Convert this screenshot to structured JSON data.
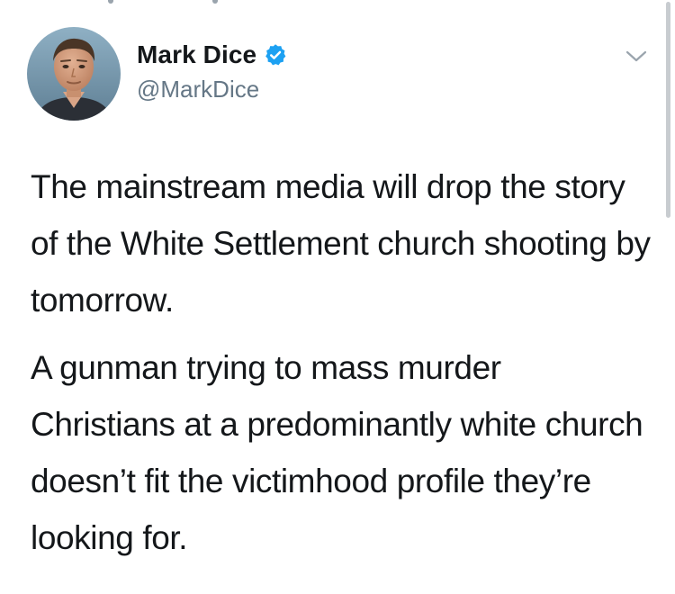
{
  "tweet": {
    "author": {
      "display_name": "Mark Dice",
      "handle": "@MarkDice",
      "verified": true,
      "verified_icon": "verified-badge-icon",
      "avatar_icon": "profile-photo"
    },
    "menu_icon": "chevron-down-icon",
    "paragraphs": [
      "The mainstream media will drop the story of the White Settlement church shooting by tomorrow.",
      "A gunman trying to mass murder Christians at a predominantly white church doesn’t fit the victimhood profile they’re looking for."
    ]
  },
  "colors": {
    "text": "#14171a",
    "secondary_text": "#657786",
    "verified_blue": "#1da1f2",
    "chevron": "#9aa4ad",
    "background": "#ffffff"
  }
}
